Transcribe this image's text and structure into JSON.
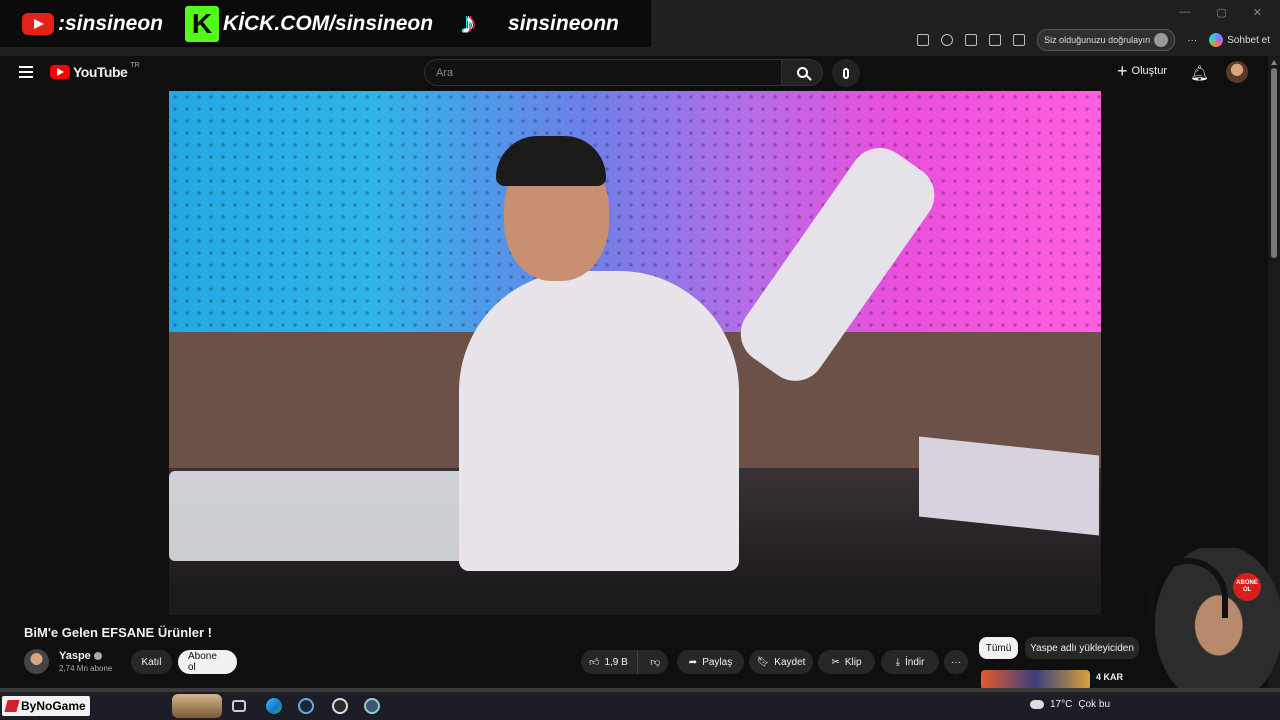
{
  "overlay": {
    "youtube_handle": ":sinsineon",
    "kick_text": "KİCK.COM/sinsineon",
    "kick_logo_letter": "K",
    "tiktok_handle": "sinsineonn"
  },
  "browser": {
    "verify_text": "Siz olduğunuzu doğrulayın",
    "chat_label": "Sohbet et",
    "more_label": "···"
  },
  "header": {
    "logo_text": "YouTube",
    "country_code": "TR",
    "search_placeholder": "Ara",
    "create_label": "Oluştur"
  },
  "video": {
    "title": "BiM'e Gelen EFSANE Ürünler !",
    "channel_name": "Yaspe",
    "subscribers": "2,74 Mn abone",
    "join_label": "Katıl",
    "subscribe_label": "Abone ol",
    "like_count": "1,9 B",
    "share_label": "Paylaş",
    "save_label": "Kaydet",
    "clip_label": "Klip",
    "download_label": "İndir",
    "more_label": "···"
  },
  "sidebar": {
    "chips": [
      "Tümü",
      "Yaspe adlı yükleyiciden"
    ],
    "rec_title": "4 KAR"
  },
  "webcam": {
    "badge_text": "ABONE OL"
  },
  "taskbar": {
    "app_label": "ByNoGame",
    "temperature": "17°C",
    "weather_text": "Çok bu"
  },
  "colors": {
    "background": "#0f0f0f",
    "youtube_red": "#ff0000",
    "kick_green": "#53fc18"
  }
}
